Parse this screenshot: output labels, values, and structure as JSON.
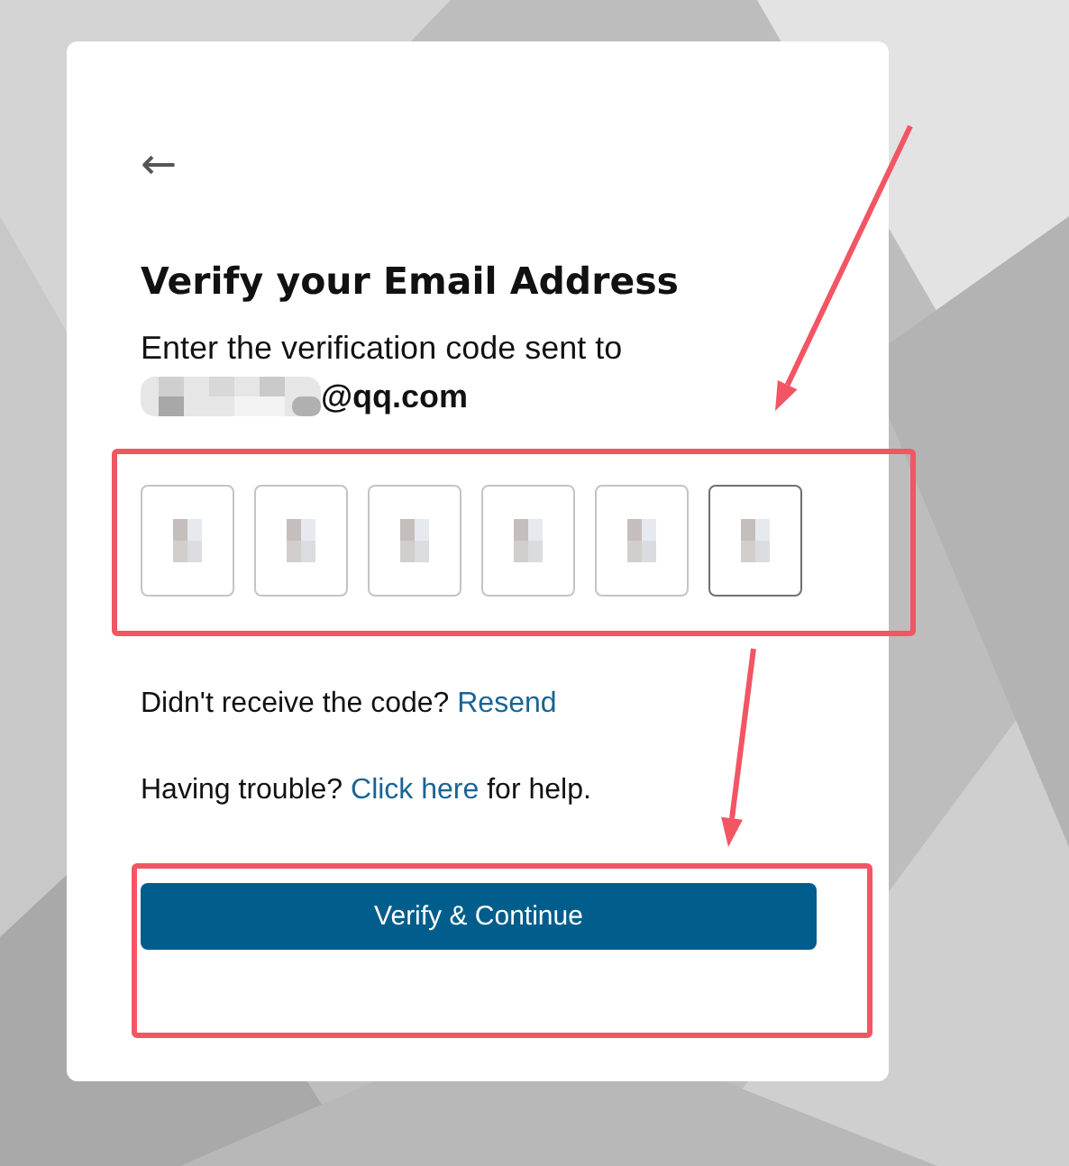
{
  "card": {
    "back_button": "←",
    "title": "Verify your Email Address",
    "subtitle": "Enter the verification code sent to",
    "email": {
      "redacted": true,
      "visible_part": "@qq.com"
    },
    "code_boxes": [
      {
        "redacted": true,
        "focused": false
      },
      {
        "redacted": true,
        "focused": false
      },
      {
        "redacted": true,
        "focused": false
      },
      {
        "redacted": true,
        "focused": false
      },
      {
        "redacted": true,
        "focused": false
      },
      {
        "redacted": true,
        "focused": true
      }
    ],
    "resend": {
      "before": "Didn't receive the code?",
      "link": "Resend"
    },
    "help": {
      "before": "Having trouble?",
      "link": "Click here",
      "after": "for help."
    },
    "submit_button": "Verify & Continue"
  },
  "annotations": [
    {
      "kind": "box"
    },
    {
      "kind": "box"
    },
    {
      "kind": "arrow"
    },
    {
      "kind": "arrow"
    }
  ]
}
